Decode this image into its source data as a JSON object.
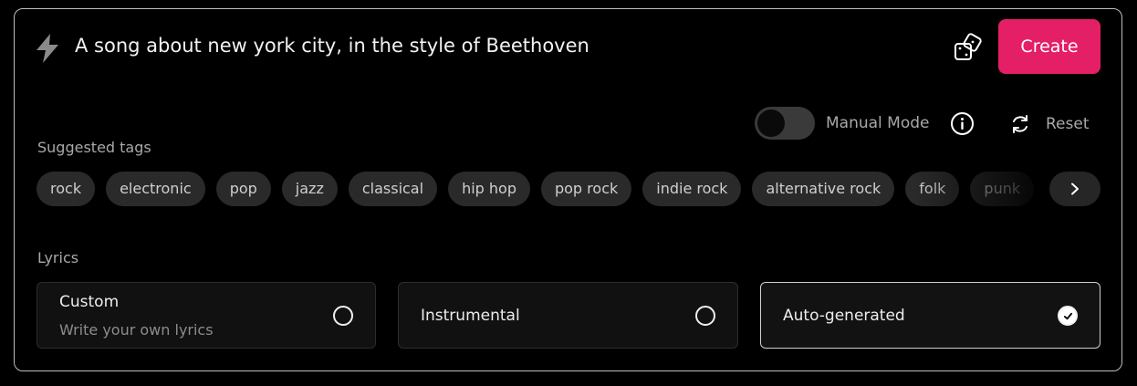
{
  "prompt": {
    "icon": "lightning-bolt-icon",
    "text": "A song about new york city, in the style of Beethoven",
    "dice_icon": "dice-icon",
    "create_label": "Create",
    "create_color": "#e41f66"
  },
  "controls": {
    "manual_mode_label": "Manual Mode",
    "manual_mode_on": false,
    "info_icon": "info-icon",
    "reset_label": "Reset",
    "reset_icon": "refresh-icon"
  },
  "suggested_tags": {
    "label": "Suggested tags",
    "items": [
      "rock",
      "electronic",
      "pop",
      "jazz",
      "classical",
      "hip hop",
      "pop rock",
      "indie rock",
      "alternative rock",
      "folk",
      "punk"
    ],
    "next_icon": "chevron-right-icon"
  },
  "lyrics": {
    "label": "Lyrics",
    "options": [
      {
        "title": "Custom",
        "subtitle": "Write your own lyrics",
        "selected": false
      },
      {
        "title": "Instrumental",
        "subtitle": "",
        "selected": false
      },
      {
        "title": "Auto-generated",
        "subtitle": "",
        "selected": true
      }
    ]
  }
}
